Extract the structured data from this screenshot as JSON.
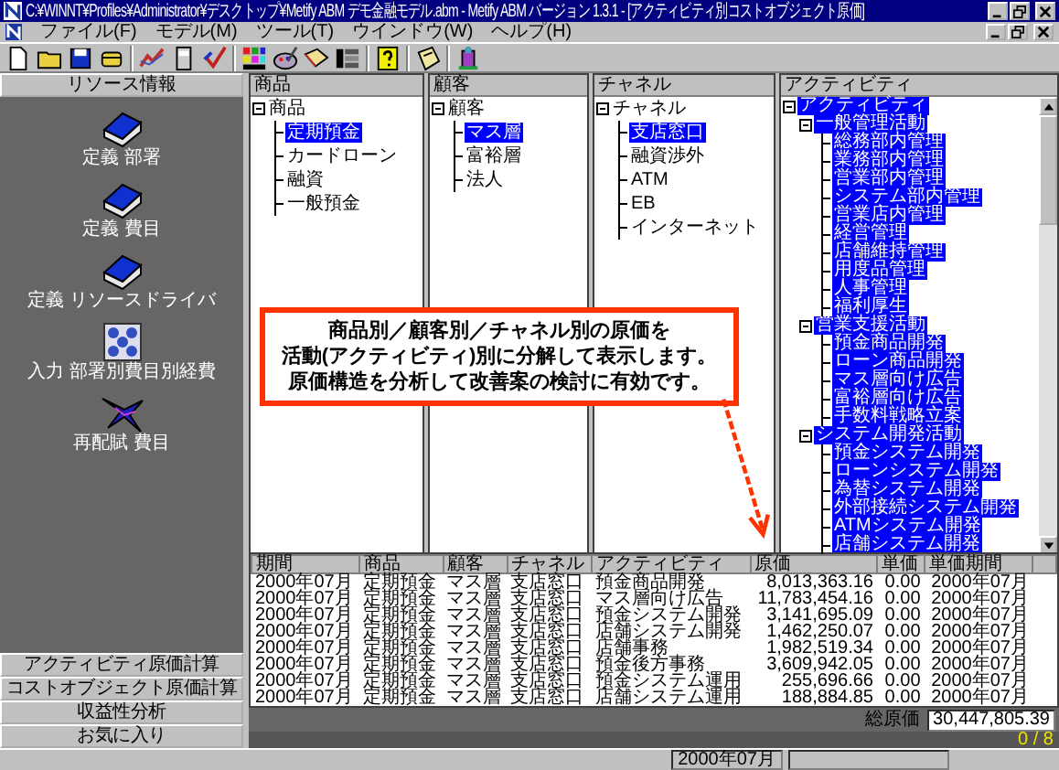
{
  "window": {
    "title": "C:¥WINNT¥Profiles¥Administrator¥デスクトップ¥Metify ABM デモ金融モデル.abm - Metify ABM バージョン 1.3.1 - [アクティビティ別コストオブジェクト原価]"
  },
  "menu": [
    "ファイル(F)",
    "モデル(M)",
    "ツール(T)",
    "ウインドウ(W)",
    "ヘルプ(H)"
  ],
  "sidebar": {
    "title": "リソース情報",
    "items": [
      {
        "label": "定義 部署",
        "kind": "book"
      },
      {
        "label": "定義 費目",
        "kind": "book"
      },
      {
        "label": "定義 リソースドライバ",
        "kind": "book"
      },
      {
        "label": "入力 部署別費目別経費",
        "kind": "grid"
      },
      {
        "label": "再配賦 費目",
        "kind": "burst"
      }
    ],
    "nav": [
      "アクティビティ原価計算",
      "コストオブジェクト原価計算",
      "収益性分析",
      "お気に入り"
    ]
  },
  "trees": [
    {
      "title": "商品",
      "nodes": [
        {
          "label": "商品",
          "expanded": true,
          "selected": false,
          "children": [
            {
              "label": "定期預金",
              "selected": true
            },
            {
              "label": "カードローン",
              "selected": false
            },
            {
              "label": "融資",
              "selected": false
            },
            {
              "label": "一般預金",
              "selected": false
            }
          ]
        }
      ]
    },
    {
      "title": "顧客",
      "nodes": [
        {
          "label": "顧客",
          "expanded": true,
          "selected": false,
          "children": [
            {
              "label": "マス層",
              "selected": true
            },
            {
              "label": "富裕層",
              "selected": false
            },
            {
              "label": "法人",
              "selected": false
            }
          ]
        }
      ]
    },
    {
      "title": "チャネル",
      "nodes": [
        {
          "label": "チャネル",
          "expanded": true,
          "selected": false,
          "children": [
            {
              "label": "支店窓口",
              "selected": true
            },
            {
              "label": "融資渉外",
              "selected": false
            },
            {
              "label": "ATM",
              "selected": false
            },
            {
              "label": "EB",
              "selected": false
            },
            {
              "label": "インターネット",
              "selected": false
            }
          ]
        }
      ]
    },
    {
      "title": "アクティビティ",
      "nodes": [
        {
          "label": "アクティビティ",
          "expanded": true,
          "selected": true,
          "children": [
            {
              "label": "一般管理活動",
              "expanded": true,
              "selected": true,
              "children": [
                {
                  "label": "総務部内管理",
                  "selected": true
                },
                {
                  "label": "業務部内管理",
                  "selected": true
                },
                {
                  "label": "営業部内管理",
                  "selected": true
                },
                {
                  "label": "システム部内管理",
                  "selected": true
                },
                {
                  "label": "営業店内管理",
                  "selected": true
                },
                {
                  "label": "経営管理",
                  "selected": true
                },
                {
                  "label": "店舗維持管理",
                  "selected": true
                },
                {
                  "label": "用度品管理",
                  "selected": true
                },
                {
                  "label": "人事管理",
                  "selected": true
                },
                {
                  "label": "福利厚生",
                  "selected": true
                }
              ]
            },
            {
              "label": "営業支援活動",
              "expanded": true,
              "selected": true,
              "children": [
                {
                  "label": "預金商品開発",
                  "selected": true
                },
                {
                  "label": "ローン商品開発",
                  "selected": true
                },
                {
                  "label": "マス層向け広告",
                  "selected": true
                },
                {
                  "label": "富裕層向け広告",
                  "selected": true
                },
                {
                  "label": "手数料戦略立案",
                  "selected": true
                }
              ]
            },
            {
              "label": "システム開発活動",
              "expanded": true,
              "selected": true,
              "children": [
                {
                  "label": "預金システム開発",
                  "selected": true
                },
                {
                  "label": "ローンシステム開発",
                  "selected": true
                },
                {
                  "label": "為替システム開発",
                  "selected": true
                },
                {
                  "label": "外部接続システム開発",
                  "selected": true
                },
                {
                  "label": "ATMシステム開発",
                  "selected": true
                },
                {
                  "label": "店舗システム開発",
                  "selected": true
                }
              ]
            }
          ]
        }
      ]
    }
  ],
  "table": {
    "columns": [
      "期間",
      "商品",
      "顧客",
      "チャネル",
      "アクティビティ",
      "原価",
      "単価",
      "単価期間"
    ],
    "rows": [
      [
        "2000年07月",
        "定期預金",
        "マス層",
        "支店窓口",
        "預金商品開発",
        "8,013,363.16",
        "0.00",
        "2000年07月"
      ],
      [
        "2000年07月",
        "定期預金",
        "マス層",
        "支店窓口",
        "マス層向け広告",
        "11,783,454.16",
        "0.00",
        "2000年07月"
      ],
      [
        "2000年07月",
        "定期預金",
        "マス層",
        "支店窓口",
        "預金システム開発",
        "3,141,695.09",
        "0.00",
        "2000年07月"
      ],
      [
        "2000年07月",
        "定期預金",
        "マス層",
        "支店窓口",
        "店舗システム開発",
        "1,462,250.07",
        "0.00",
        "2000年07月"
      ],
      [
        "2000年07月",
        "定期預金",
        "マス層",
        "支店窓口",
        "店舗事務",
        "1,982,519.34",
        "0.00",
        "2000年07月"
      ],
      [
        "2000年07月",
        "定期預金",
        "マス層",
        "支店窓口",
        "預金後方事務",
        "3,609,942.05",
        "0.00",
        "2000年07月"
      ],
      [
        "2000年07月",
        "定期預金",
        "マス層",
        "支店窓口",
        "預金システム運用",
        "255,696.66",
        "0.00",
        "2000年07月"
      ],
      [
        "2000年07月",
        "定期預金",
        "マス層",
        "支店窓口",
        "店舗システム運用",
        "188,884.85",
        "0.00",
        "2000年07月"
      ]
    ]
  },
  "total": {
    "label": "総原価",
    "value": "30,447,805.39"
  },
  "record_count": "0 / 8",
  "status_bar": {
    "period": "2000年07月"
  },
  "callout": [
    "商品別／顧客別／チャネル別の原価を",
    "活動(アクティビティ)別に分解して表示します。",
    "原価構造を分析して改善案の検討に有効です。"
  ]
}
